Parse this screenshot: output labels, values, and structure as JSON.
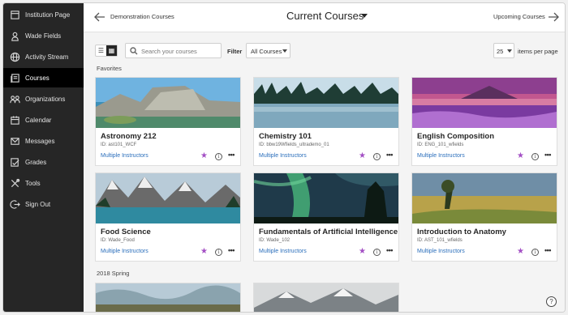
{
  "sidebar": {
    "items": [
      {
        "label": "Institution Page",
        "icon": "institution-icon"
      },
      {
        "label": "Wade Fields",
        "icon": "user-icon"
      },
      {
        "label": "Activity Stream",
        "icon": "globe-icon"
      },
      {
        "label": "Courses",
        "icon": "courses-icon",
        "active": true
      },
      {
        "label": "Organizations",
        "icon": "organizations-icon"
      },
      {
        "label": "Calendar",
        "icon": "calendar-icon"
      },
      {
        "label": "Messages",
        "icon": "messages-icon"
      },
      {
        "label": "Grades",
        "icon": "grades-icon"
      },
      {
        "label": "Tools",
        "icon": "tools-icon"
      },
      {
        "label": "Sign Out",
        "icon": "sign-out-icon"
      }
    ]
  },
  "header": {
    "back_label": "Demonstration Courses",
    "title": "Current Courses",
    "forward_label": "Upcoming Courses"
  },
  "toolbar": {
    "search_placeholder": "Search your courses",
    "filter_label": "Filter",
    "filter_value": "All Courses",
    "per_page_value": "25",
    "per_page_label": "items per page"
  },
  "sections": {
    "favorites": "Favorites",
    "spring": "2018 Spring"
  },
  "courses": [
    {
      "title": "Astronomy 212",
      "id": "ID: ast101_WCF",
      "instructors": "Multiple Instructors"
    },
    {
      "title": "Chemistry 101",
      "id": "ID: bbw19Wfields_ultrademo_01",
      "instructors": "Multiple Instructors"
    },
    {
      "title": "English Composition",
      "id": "ID: ENG_101_wfields",
      "instructors": "Multiple Instructors"
    },
    {
      "title": "Food Science",
      "id": "ID: Wade_Food",
      "instructors": "Multiple Instructors"
    },
    {
      "title": "Fundamentals of Artificial Intelligence",
      "id": "ID: Wade_102",
      "instructors": "Multiple Instructors"
    },
    {
      "title": "Introduction to Anatomy",
      "id": "ID: AST_101_wfields",
      "instructors": "Multiple Instructors"
    }
  ],
  "colors": {
    "sidebar_bg": "#262626",
    "favorite_star": "#a34fc4",
    "link": "#2a6ebb"
  },
  "help": "?"
}
